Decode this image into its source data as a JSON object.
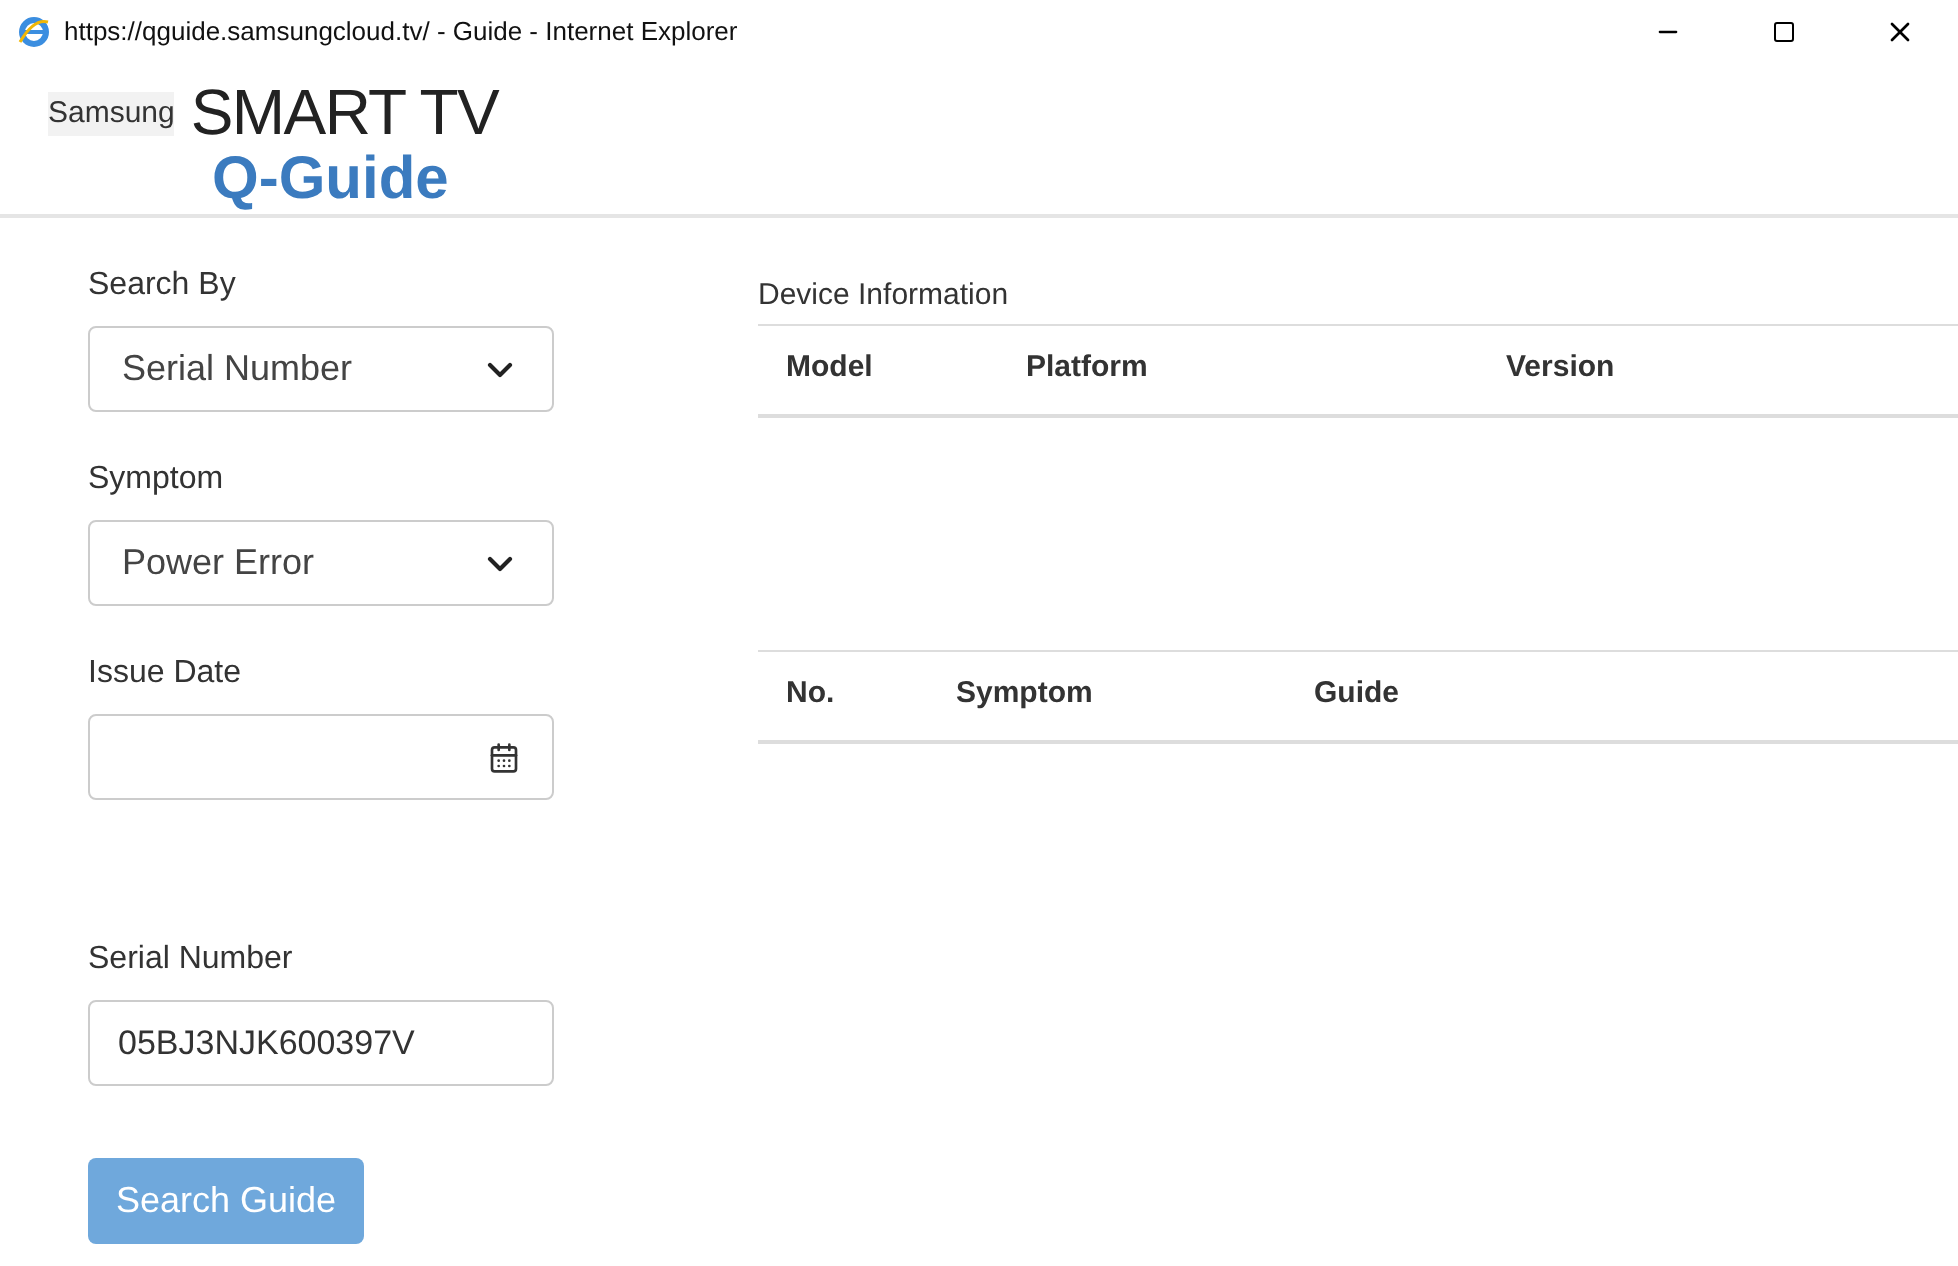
{
  "window": {
    "title": "https://qguide.samsungcloud.tv/ - Guide - Internet Explorer"
  },
  "logo": {
    "brand": "Samsung",
    "product": "SMART TV",
    "app": "Q-Guide"
  },
  "form": {
    "fields": [
      {
        "kind": "select",
        "label": "Search By",
        "value": "Serial Number"
      },
      {
        "kind": "select",
        "label": "Symptom",
        "value": "Power Error"
      },
      {
        "kind": "date",
        "label": "Issue Date"
      },
      {
        "kind": "text",
        "label": "Serial Number",
        "value": "05BJ3NJK600397V"
      }
    ],
    "button": "Search Guide"
  },
  "device_info": {
    "title": "Device Information",
    "columns": [
      "Model",
      "Platform",
      "Version"
    ]
  },
  "guide_table": {
    "columns": [
      "No.",
      "Symptom",
      "Guide"
    ]
  }
}
